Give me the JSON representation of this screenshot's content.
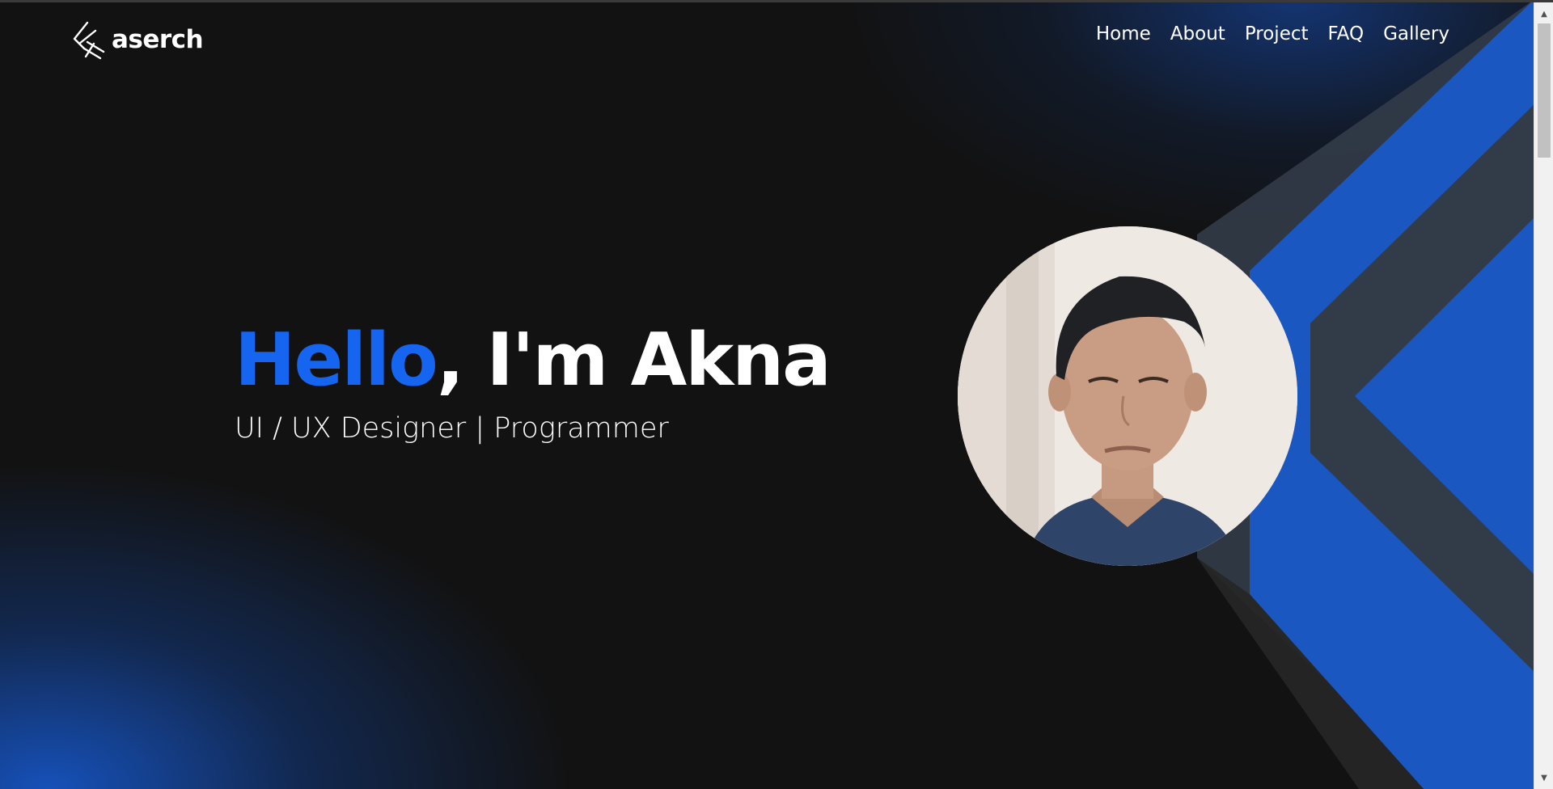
{
  "brand": {
    "name": "aserch",
    "logo_icon": "aserch-logo-icon"
  },
  "nav": {
    "items": [
      {
        "label": "Home"
      },
      {
        "label": "About"
      },
      {
        "label": "Project"
      },
      {
        "label": "FAQ"
      },
      {
        "label": "Gallery"
      }
    ]
  },
  "hero": {
    "greeting_accent": "Hello",
    "greeting_rest": ", I'm Akna",
    "subtitle": "UI / UX Designer | Programmer",
    "photo_icon": "profile-photo"
  },
  "colors": {
    "background": "#121212",
    "accent": "#1565f0",
    "chevron_blue": "#1a57c1",
    "chevron_gray": "#323b48",
    "text": "#ffffff"
  },
  "scrollbar": {
    "up_icon": "scroll-up-arrow",
    "down_icon": "scroll-down-arrow"
  }
}
